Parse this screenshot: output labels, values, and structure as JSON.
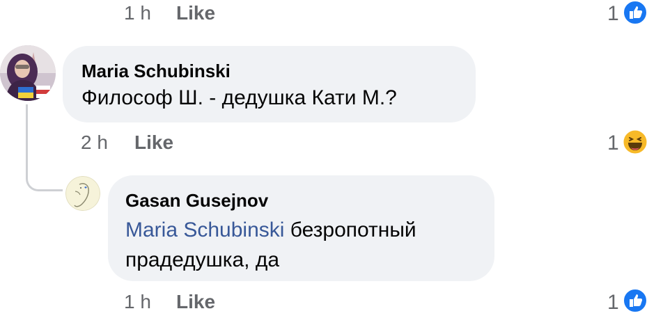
{
  "colors": {
    "like_blue": "#1877f2",
    "mention_blue": "#385898",
    "bubble": "#f0f2f5",
    "meta_grey": "#65676b",
    "haha_yellow": "#f7b928"
  },
  "top_row": {
    "time": "1 h",
    "like": "Like",
    "reaction_count": "1",
    "reaction_icon": "like-icon"
  },
  "comment1": {
    "author": "Maria Schubinski",
    "text": "Философ Ш. - дедушка Кати М.?",
    "time": "2 h",
    "like": "Like",
    "reaction_count": "1",
    "reaction_icon": "haha-icon"
  },
  "reply1": {
    "author": "Gasan Gusejnov",
    "mention": "Maria Schubinski",
    "text_line1": " безропотный",
    "text_line2": "прадедушка, да",
    "time": "1 h",
    "like": "Like",
    "reaction_count": "1",
    "reaction_icon": "like-icon"
  }
}
